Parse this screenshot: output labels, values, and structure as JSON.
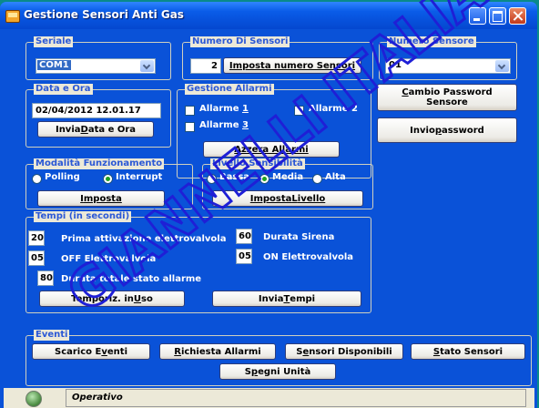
{
  "window": {
    "title": "Gestione Sensori Anti Gas"
  },
  "seriale": {
    "legend": "Seriale",
    "value": "COM1"
  },
  "numero_di_sensori": {
    "legend": "Numero Di Sensori",
    "value": "2",
    "button": "Imposta numero Sensori"
  },
  "numero_sensore": {
    "legend": "Numero Sensore",
    "value": "01"
  },
  "data_ora": {
    "legend": "Data e Ora",
    "value": "02/04/2012 12.01.17",
    "button_prefix": "Invia ",
    "button_mnemonic": "D",
    "button_suffix": "ata e Ora"
  },
  "gestione_allarmi": {
    "legend": "Gestione Allarmi",
    "allarme1": {
      "text": "Allarme ",
      "mnemonic": "1"
    },
    "allarme2": "Allarme 2",
    "allarme3": {
      "text": "Allarme ",
      "mnemonic": "3"
    },
    "button_mnemonic": "A",
    "button_suffix": "zzera Allarmi"
  },
  "cambio_password": {
    "mnemonic": "C",
    "line1": "ambio Password",
    "line2": "Sensore"
  },
  "invio_password": {
    "prefix": "Invio ",
    "mnemonic": "p",
    "suffix": "assword"
  },
  "modalita": {
    "legend": "Modalità Funzionamento",
    "polling": "Polling",
    "interrupt": "Interrupt",
    "selected": "Interrupt",
    "button_mnemonic": "I",
    "button_suffix": "mposta"
  },
  "livello": {
    "legend": "Livello Sensibilità",
    "bassa": "Bassa",
    "media": "Media",
    "alta": "Alta",
    "selected": "Media",
    "button_prefix": "Imposta ",
    "button_mnemonic": "L",
    "button_suffix": "ivello"
  },
  "tempi": {
    "legend": "Tempi (in secondi)",
    "prima_attivazione": {
      "value": "20",
      "label": "Prima attivazione elettrovalvola"
    },
    "durata_sirena": {
      "value": "60",
      "label": "Durata Sirena"
    },
    "off_elettrovalvola": {
      "value": "05",
      "label": "OFF Elettrovalvola"
    },
    "on_elettrovalvola": {
      "value": "05",
      "label": "ON Elettrovalvola"
    },
    "durata_totale": {
      "value": "80",
      "label": "Durata totale stato allarme"
    },
    "temporiz": {
      "prefix": "Temporiz. in ",
      "mnemonic": "U",
      "suffix": "so"
    },
    "invia": {
      "prefix": "Invia ",
      "mnemonic": "T",
      "suffix": "empi"
    }
  },
  "eventi": {
    "legend": "Eventi",
    "scarico": {
      "prefix": "Scarico E",
      "mnemonic": "v",
      "suffix": "enti"
    },
    "richiesta": {
      "prefix": "",
      "mnemonic": "R",
      "suffix": "ichiesta Allarmi"
    },
    "sensori_disp": {
      "prefix": "S",
      "mnemonic": "e",
      "suffix": "nsori Disponibili"
    },
    "stato": {
      "prefix": "",
      "mnemonic": "S",
      "suffix": "tato Sensori"
    },
    "spegni": {
      "prefix": "S",
      "mnemonic": "p",
      "suffix": "egni Unità"
    }
  },
  "status": {
    "text": "Operativo"
  },
  "watermark": {
    "text": "GIANNELLI ITALIA",
    "color": "#1f1fd6"
  },
  "colors": {
    "titlebar": "#0a5ce8",
    "legend": "#2b58d6",
    "client": "#ece9d8",
    "client_blue": "#0a52d8"
  }
}
